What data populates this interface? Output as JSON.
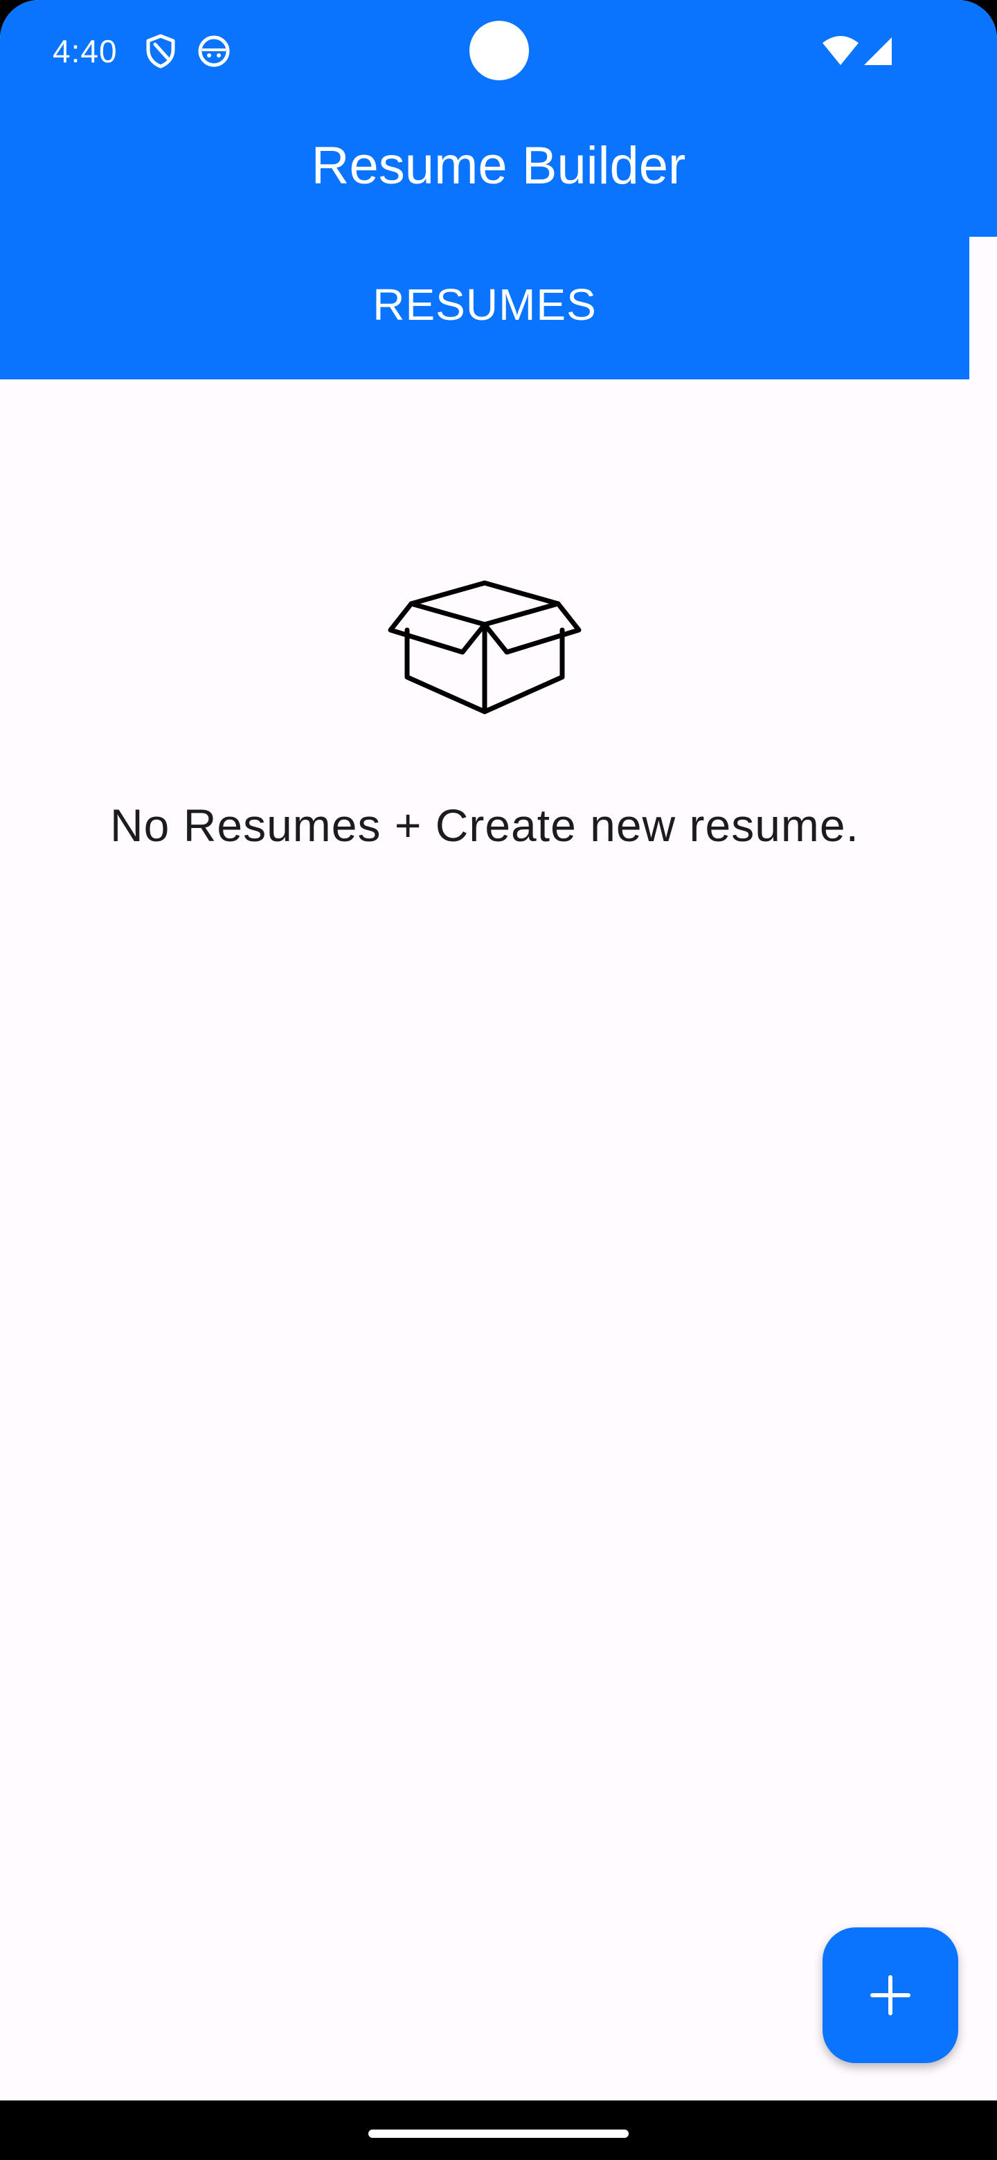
{
  "status_bar": {
    "time": "4:40",
    "icons": [
      "shield-icon",
      "android-face-icon",
      "wifi-icon",
      "cellular-signal-icon"
    ]
  },
  "app_bar": {
    "title": "Resume Builder"
  },
  "tabs": [
    {
      "label": "RESUMES",
      "selected": true
    }
  ],
  "empty_state": {
    "icon": "open-box-icon",
    "message": "No Resumes + Create new resume."
  },
  "fab": {
    "icon": "plus-icon"
  },
  "colors": {
    "primary": "#0a74ff",
    "background": "#fffbfe",
    "text": "#1c1b1f",
    "on_primary": "#ffffff"
  }
}
